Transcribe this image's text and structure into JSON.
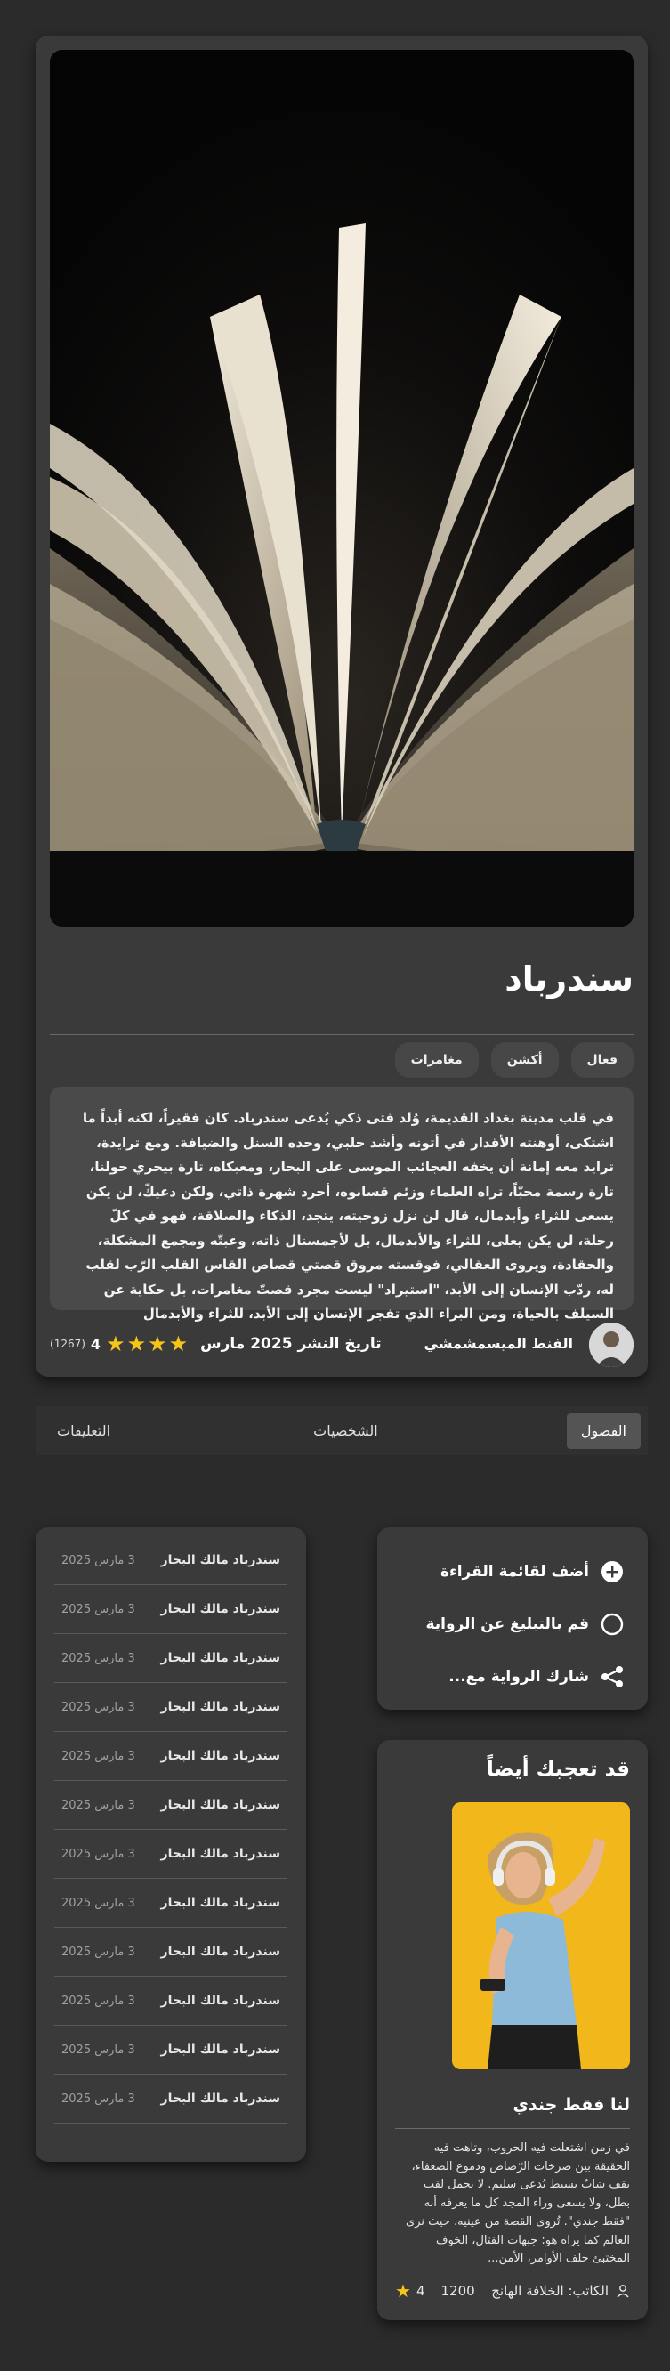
{
  "novel": {
    "title": "سندرباد",
    "tags": [
      "فعال",
      "أكشن",
      "مغامرات"
    ],
    "summary": "في قلب مدينة بغداد القديمة، وُلد فتى ذكي يُدعى سندرباد. كان فقيراً، لكنه أبداً ما اشتكى، أوهنته الأقدار في أتونه وأشد حلبي، وحده السنل والضيافة. ومع ترايدة، ترايد معه إمانة أن يخفه العجائب الموسى على البحار، ومعبكاه، تارة بيحري حولنا، تارة رسمة محبّاً، تراه العلماء وزئم قسانوه، أحرد شهرة ذاتي، ولكن دعيكّ، لن يكن يسعى للثراء وأبدمال، قال لن نزل زوجيته، يتجد، الذكاء والصلاقة، فهو في كلّ رحلة، لن يكن يعلى، للثراء والأبدمال، بل لأجمسنال ذاته، وعبتّه ومجمع المشكلة، والحقادة، ويروى العقالي، فوقسته مروق قصتي قصاص القاس القلب الرّب لقلب له، ردّب الإنسان إلى الأبد، \"استيراد\" ليست مجرد قصتّ مغامرات، بل حكاية عن السيلف بالحياة، ومن البراء الذي تفجر الإنسان إلى الأبد، للثراء والأبدمال",
    "author": "الفنط الميسمشمشي",
    "rating": "4",
    "rating_count": "(1267)",
    "stars": 4,
    "publish_date": "تاريخ النشر 2025 مارس"
  },
  "tabs": [
    {
      "label": "الفصول",
      "active": true
    },
    {
      "label": "الشخصيات",
      "active": false
    },
    {
      "label": "التعليقات",
      "active": false
    }
  ],
  "chapters": [
    {
      "title": "سندرباد مالك البحار",
      "date": "3 مارس 2025"
    },
    {
      "title": "سندرباد مالك البحار",
      "date": "3 مارس 2025"
    },
    {
      "title": "سندرباد مالك البحار",
      "date": "3 مارس 2025"
    },
    {
      "title": "سندرباد مالك البحار",
      "date": "3 مارس 2025"
    },
    {
      "title": "سندرباد مالك البحار",
      "date": "3 مارس 2025"
    },
    {
      "title": "سندرباد مالك البحار",
      "date": "3 مارس 2025"
    },
    {
      "title": "سندرباد مالك البحار",
      "date": "3 مارس 2025"
    },
    {
      "title": "سندرباد مالك البحار",
      "date": "3 مارس 2025"
    },
    {
      "title": "سندرباد مالك البحار",
      "date": "3 مارس 2025"
    },
    {
      "title": "سندرباد مالك البحار",
      "date": "3 مارس 2025"
    },
    {
      "title": "سندرباد مالك البحار",
      "date": "3 مارس 2025"
    },
    {
      "title": "سندرباد مالك البحار",
      "date": "3 مارس 2025"
    }
  ],
  "actions": [
    {
      "label": "أضف لقائمة القراءة",
      "icon": "plus-circle-icon"
    },
    {
      "label": "قم بالتبليغ عن الرواية",
      "icon": "circle-icon"
    },
    {
      "label": "شارك الرواية مع...",
      "icon": "share-icon"
    }
  ],
  "recommend": {
    "heading": "قد تعجبك أيضاً",
    "title": "لنا فقط جندي",
    "summary": "في زمن اشتعلت فيه الحروب، وتاهت فيه الحقيقة بين صرخات الرّصاص ودموع الضعفاء، يقف شابٌ بسيط يُدعى سليم. لا يحمل لقب بطل، ولا يسعى وراء المجد كل ما يعرفه أنه \"فقط جندي\". تُروى القصة من عينيه، حيث نرى العالم كما يراه هو: جبهات القتال، الخوف المختبئ خلف الأوامر، الأمن...",
    "author": "الكاتب: الخلافة الهانج",
    "views": "1200",
    "rating": "4"
  },
  "colors": {
    "background": "#2b2b2b",
    "card": "#3a3a3a",
    "star": "#f5c518"
  }
}
